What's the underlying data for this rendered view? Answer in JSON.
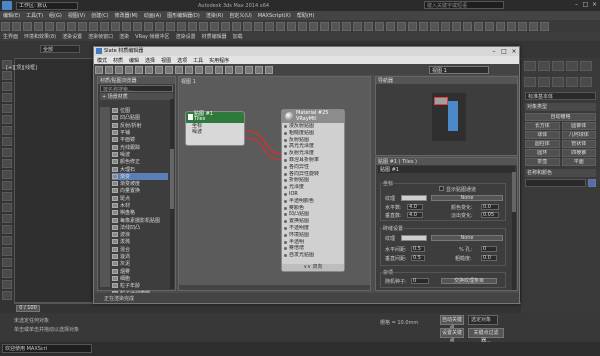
{
  "titlebar": {
    "workspace": "工作区: 默认",
    "app_title": "Autodesk 3ds Max 2014 x64",
    "search_placeholder": "键入关键字或短语"
  },
  "menu": [
    "编辑(E)",
    "工具(T)",
    "组(G)",
    "视图(V)",
    "创建(C)",
    "修改器(M)",
    "动画(A)",
    "图形编辑器(D)",
    "渲染(R)",
    "自定义(U)",
    "MAXScript(X)",
    "帮助(H)"
  ],
  "toolbar2": [
    "生界面",
    "环境和效果(8)",
    "渲染设置",
    "渲染帧窗口",
    "渲染",
    "VRay 帧缓冲区",
    "渲染设置",
    "材质编辑器",
    "加载"
  ],
  "toolbar_combo": "全部",
  "viewport_label": "[+][顶][线框]",
  "slate": {
    "title": "Slate 材质编辑器",
    "menu": [
      "模式",
      "材质",
      "编辑",
      "选择",
      "视图",
      "选项",
      "工具",
      "实用程序"
    ],
    "view_combo": "视图 1",
    "browser_header": "材质/贴图浏览器",
    "browser_search": "按名称搜索...",
    "browser_section": "+ 场景材质",
    "browser_items": [
      "位图",
      "凹凸贴图",
      "反射/折射",
      "平铺",
      "平面镜",
      "光线跟踪",
      "噪波",
      "颜色修正",
      "大理石",
      "渐变",
      "渐变坡度",
      "向量置换",
      "斑点",
      "木材",
      "棋盘格",
      "每像素摄影机贴图",
      "法线凹凸",
      "波浪",
      "泼溅",
      "混合",
      "漩涡",
      "灰泥",
      "烟雾",
      "细胞",
      "粒子年龄",
      "粒子运动模糊"
    ],
    "selected_index": 9,
    "canvas_label": "视图 1",
    "node1": {
      "title": "贴图 #1",
      "subtitle": "Tiles",
      "rows": [
        "坐标",
        "噪波"
      ]
    },
    "node2": {
      "title": "Material #25",
      "subtitle": "VRayMtl",
      "rows": [
        "漫反射贴图",
        "粗糙度贴图",
        "反射贴图",
        "高光光泽度",
        "反射光泽度",
        "菲涅耳折射率",
        "各向异性",
        "各向异性旋转",
        "折射贴图",
        "光泽度",
        "IOR",
        "半透明颜色",
        "雾颜色",
        "凹凸贴图",
        "置换贴图",
        "不透明度",
        "环境贴图",
        "半透明",
        "雾倍增",
        "自发光贴图"
      ],
      "footer": "∨∨ 双向"
    },
    "nav_title": "导航器",
    "params_title": "贴图 #1  ( Tiles )",
    "params_node": "贴图 #1",
    "coords": {
      "header": "坐标",
      "show_map": "显示贴图通道",
      "texture_label": "纹理",
      "texture_value": "None",
      "h_count_label": "水平数:",
      "h_count": "4.0",
      "v_count_label": "垂直数:",
      "v_count": "4.0",
      "color_var_label": "颜色变化:",
      "color_var": "0.0",
      "fade_var_label": "淡出变化:",
      "fade_var": "0.05"
    },
    "grout": {
      "header": "砖缝设置",
      "texture_label": "纹理",
      "texture_value": "None",
      "h_gap_label": "水平间距:",
      "h_gap": "0.5",
      "v_gap_label": "垂直间距:",
      "v_gap": "0.5",
      "pct_label": "% 孔:",
      "pct": "0",
      "rough_label": "粗糙度:",
      "rough": "0.0"
    },
    "misc": {
      "header": "杂项",
      "seed_label": "随机种子:",
      "seed": "0",
      "swap_btn": "交换纹理条目"
    },
    "status": "正在渲染完成"
  },
  "right": {
    "combo": "标准基本体",
    "rollout1": "对象类型",
    "buttons": [
      "自动栅格",
      "长方体",
      "圆锥体",
      "球体",
      "几何球体",
      "圆柱体",
      "管状体",
      "圆环",
      "四棱锥",
      "茶壶",
      "平面"
    ],
    "rollout2": "名称和颜色"
  },
  "timeline": "0 / 100",
  "status": {
    "line1": "未选定任何对象",
    "line2": "单击或单击并拖动以选择对象",
    "cmd": "欢迎使用 MAXScri",
    "grid": "栅格 = 10.0mm",
    "autokey": "自动关键点",
    "selected": "选定对象",
    "setkey": "设置关键点",
    "keyfilter": "关键点过滤器..."
  }
}
